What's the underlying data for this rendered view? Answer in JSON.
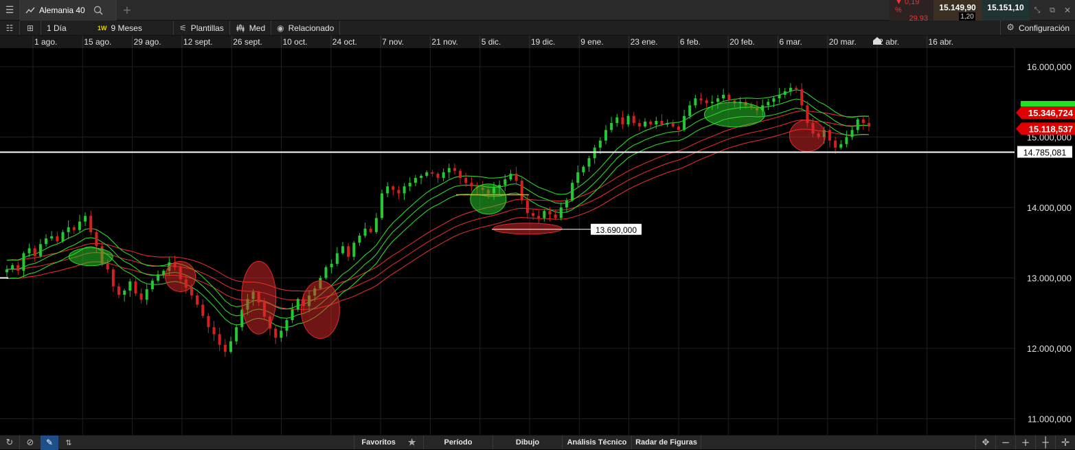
{
  "header": {
    "instrument": "Alemania 40",
    "change_pct": "0,19 %",
    "change_abs": "29,93",
    "bid": "15.149,90",
    "spread": "1,20",
    "ask": "15.151,10"
  },
  "toolbar": {
    "interval": "1 Día",
    "week_badge": "1W",
    "range": "9 Meses",
    "templates": "Plantillas",
    "median": "Med",
    "related": "Relacionado",
    "settings": "Configuración"
  },
  "bottom": {
    "favorites": "Favoritos",
    "period": "Período",
    "drawing": "Dibujo",
    "technical": "Análisis Técnico",
    "patterns": "Radar de Figuras"
  },
  "colors": {
    "up": "#22c933",
    "down": "#d42020",
    "env_green": "#2bd62b",
    "env_red": "#e02a2a",
    "bg": "#000000"
  },
  "chart_data": {
    "type": "candlestick",
    "x_ticks": [
      "1 ago.",
      "15 ago.",
      "29 ago.",
      "12 sept.",
      "26 sept.",
      "10 oct.",
      "24 oct.",
      "7 nov.",
      "21 nov.",
      "5 dic.",
      "19 dic.",
      "9 ene.",
      "23 ene.",
      "6 feb.",
      "20 feb.",
      "6 mar.",
      "20 mar.",
      "2 abr.",
      "16 abr."
    ],
    "y_ticks": [
      "11.000,000",
      "12.000,000",
      "13.000,000",
      "14.000,000",
      "15.000,000",
      "16.000,000"
    ],
    "ylim": [
      10700,
      16350
    ],
    "price_labels": {
      "ask_line": "15.346,724",
      "bid_line": "15.118,537",
      "support": "14.785,081",
      "annotation": "13.690,000"
    },
    "levels": {
      "support": 14785,
      "annotation": 13690,
      "ask_line": 15346.7,
      "bid_line": 15118.5
    },
    "closes": [
      13120,
      13180,
      13100,
      13350,
      13420,
      13310,
      13480,
      13560,
      13590,
      13520,
      13650,
      13720,
      13680,
      13800,
      13880,
      13650,
      13450,
      13200,
      13120,
      12880,
      12760,
      12820,
      12950,
      12780,
      12690,
      12840,
      12960,
      13050,
      13100,
      13220,
      13150,
      12980,
      12860,
      12750,
      12620,
      12460,
      12300,
      12200,
      12050,
      11950,
      12100,
      12300,
      12550,
      12700,
      12800,
      12650,
      12450,
      12280,
      12150,
      12250,
      12400,
      12550,
      12700,
      12600,
      12750,
      12850,
      13000,
      13150,
      13200,
      13350,
      13450,
      13300,
      13500,
      13600,
      13700,
      13650,
      13850,
      14200,
      14300,
      14250,
      14200,
      14300,
      14350,
      14420,
      14450,
      14500,
      14480,
      14420,
      14500,
      14560,
      14520,
      14420,
      14350,
      14300,
      14280,
      14250,
      14200,
      14280,
      14320,
      14400,
      14480,
      14380,
      14100,
      13920,
      13880,
      13850,
      13950,
      13900,
      13850,
      14000,
      14100,
      14350,
      14500,
      14580,
      14700,
      14850,
      14950,
      15100,
      15200,
      15280,
      15180,
      15300,
      15200,
      15150,
      15220,
      15180,
      15230,
      15180,
      15200,
      15150,
      15100,
      15300,
      15450,
      15550,
      15520,
      15480,
      15500,
      15550,
      15600,
      15520,
      15480,
      15500,
      15450,
      15420,
      15380,
      15450,
      15500,
      15550,
      15600,
      15650,
      15700,
      15680,
      15450,
      15200,
      15050,
      15000,
      15100,
      14950,
      14850,
      14900,
      15000,
      15100,
      15250,
      15200,
      15150
    ]
  }
}
